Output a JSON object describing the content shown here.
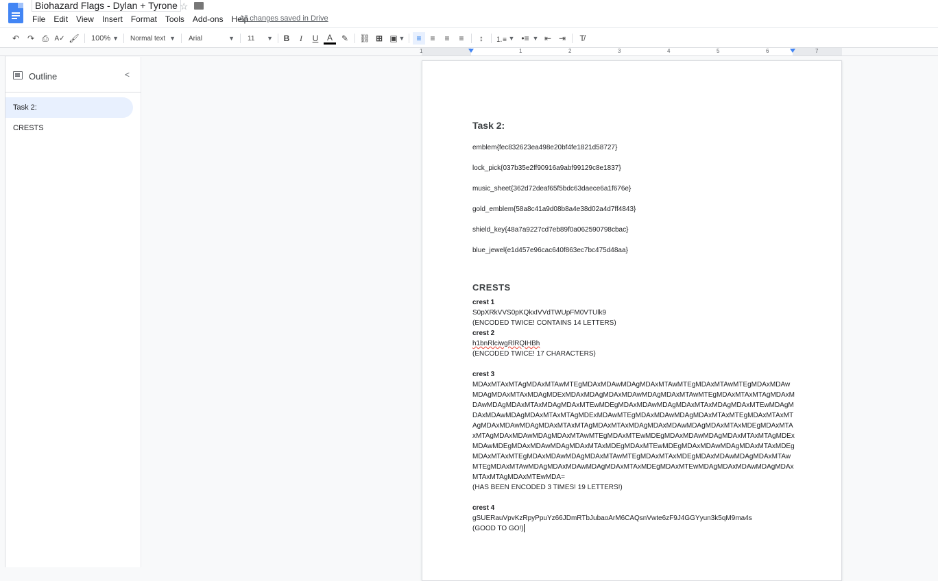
{
  "app": {
    "title": "Biohazard Flags - Dylan + Tyrone",
    "saved_status": "All changes saved in Drive",
    "menu": [
      "File",
      "Edit",
      "View",
      "Insert",
      "Format",
      "Tools",
      "Add-ons",
      "Help"
    ]
  },
  "toolbar": {
    "zoom": "100%",
    "style": "Normal text",
    "font": "Arial",
    "font_size": "11"
  },
  "ruler": {
    "numbers": [
      "1",
      "1",
      "2",
      "3",
      "4",
      "5",
      "6",
      "7"
    ]
  },
  "outline": {
    "title": "Outline",
    "items": [
      {
        "label": "Task 2:",
        "active": true
      },
      {
        "label": "CRESTS",
        "active": false
      }
    ]
  },
  "document": {
    "task_heading": "Task 2:",
    "flags": [
      "emblem{fec832623ea498e20bf4fe1821d58727}",
      "lock_pick{037b35e2ff90916a9abf99129c8e1837}",
      "music_sheet{362d72deaf65f5bdc63daece6a1f676e}",
      "gold_emblem{58a8c41a9d08b8a4e38d02a4d7ff4843}",
      "shield_key{48a7a9227cd7eb89f0a062590798cbac}",
      "blue_jewel{e1d457e96cac640f863ec7bc475d48aa}"
    ],
    "crests_heading": "CRESTS",
    "crest1_label": "crest 1",
    "crest1_value": "S0pXRkVVS0pKQkxIVVdTWUpFM0VTUlk9",
    "crest1_note": "(ENCODED TWICE! CONTAINS 14 LETTERS)",
    "crest2_label": "crest 2",
    "crest2_value": "h1bnRlciwgRlRQIHBh",
    "crest2_note": "(ENCODED TWICE! 17 CHARACTERS)",
    "crest3_label": "crest 3",
    "crest3_value": "MDAxMTAxMTAgMDAxMTAwMTEgMDAxMDAwMDAgMDAxMTAwMTEgMDAxMTAwMTEgMDAxMDAwMDAgMDAxMTAxMDAgMDExMDAxMDAgMDAxMDAwMDAgMDAxMTAwMTEgMDAxMTAxMTAgMDAxMDAwMDAgMDAxMTAxMDAgMDAxMTEwMDEgMDAxMDAwMDAgMDAxMTAxMDAgMDAxMTEwMDAgMDAxMDAwMDAgMDAxMTAxMTAgMDExMDAwMTEgMDAxMDAwMDAgMDAxMTAxMTEgMDAxMTAxMTAgMDAxMDAwMDAgMDAxMTAxMTAgMDAxMTAxMDAgMDAxMDAwMDAgMDAxMTAxMDEgMDAxMTAxMTAgMDAxMDAwMDAgMDAxMTAwMTEgMDAxMTEwMDEgMDAxMDAwMDAgMDAxMTAxMTAgMDExMDAwMDEgMDAxMDAwMDAgMDAxMTAxMDEgMDAxMTEwMDEgMDAxMDAwMDAgMDAxMTAxMDEgMDAxMTAxMTEgMDAxMDAwMDAgMDAxMTAwMTEgMDAxMTAxMDEgMDAxMDAwMDAgMDAxMTAwMTEgMDAxMTAwMDAgMDAxMDAwMDAgMDAxMTAxMDEgMDAxMTEwMDAgMDAxMDAwMDAgMDAxMTAxMTAgMDAxMTEwMDA=",
    "crest3_note": "(HAS BEEN ENCODED 3 TIMES! 19 LETTERS!)",
    "crest4_label": "crest 4",
    "crest4_value": "gSUERauVpvKzRpyPpuYz66JDmRTbJubaoArM6CAQsnVwte6zF9J4GGYyun3k5qM9ma4s",
    "crest4_note": "(GOOD TO GO!)"
  }
}
